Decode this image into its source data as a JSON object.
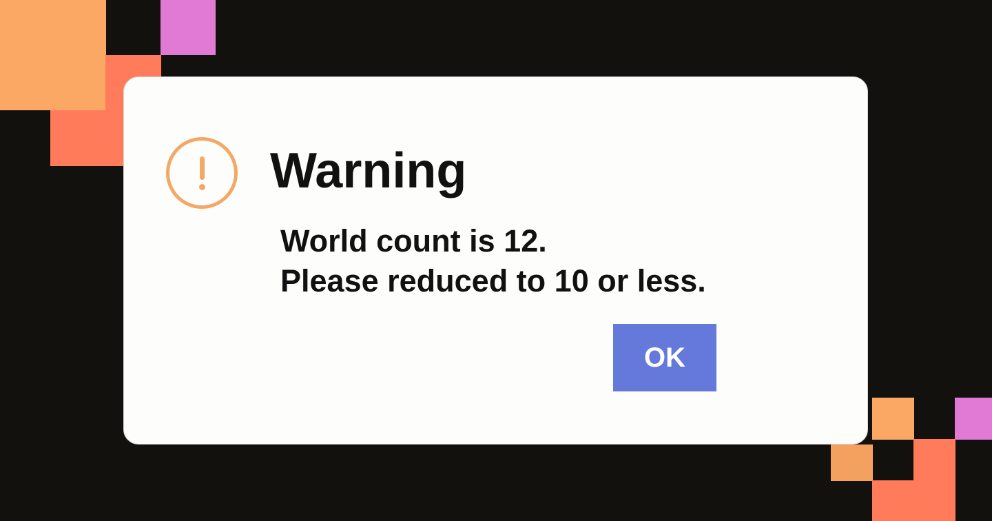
{
  "background_color": "#12110e",
  "decoration_colors": {
    "orange": "#fca865",
    "coral": "#ff7b59",
    "pink": "#e07ad5"
  },
  "dialog": {
    "icon": "exclamation-circle-icon",
    "icon_color": "#f4a867",
    "title": "Warning",
    "message_lines": [
      "World count is 12.",
      "Please reduced to 10 or less."
    ],
    "ok_label": "OK",
    "button_color": "#6479d9"
  }
}
